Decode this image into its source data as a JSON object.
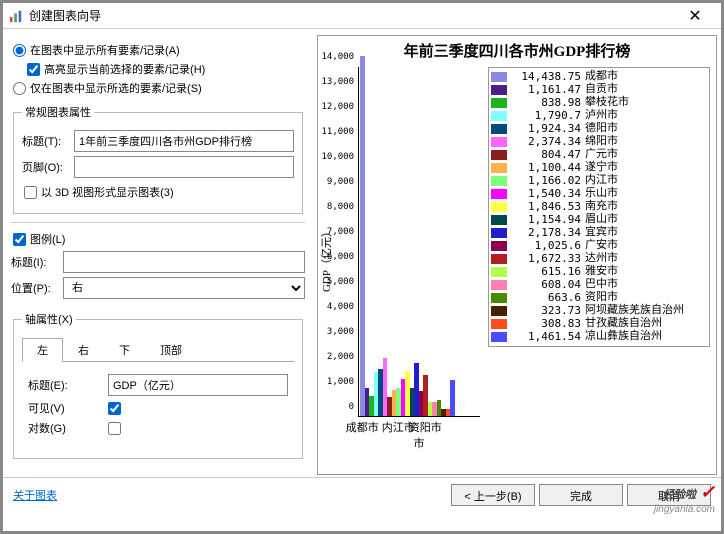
{
  "window": {
    "title": "创建图表向导"
  },
  "options": {
    "show_all": "在图表中显示所有要素/记录(A)",
    "highlight": "高亮显示当前选择的要素/记录(H)",
    "show_selected": "仅在图表中显示所选的要素/记录(S)"
  },
  "general_props": {
    "legend": "常规图表属性",
    "title_label": "标题(T):",
    "title_value": "1年前三季度四川各市州GDP排行榜",
    "footer_label": "页脚(O):",
    "footer_value": "",
    "show_3d": "以 3D 视图形式显示图表(3)"
  },
  "legend_group": {
    "enable": "图例(L)",
    "title_label": "标题(I):",
    "title_value": "",
    "position_label": "位置(P):",
    "position_value": "右"
  },
  "axis_group": {
    "legend": "轴属性(X)",
    "tabs": {
      "left": "左",
      "right": "右",
      "bottom": "下",
      "top": "顶部"
    },
    "title_label": "标题(E):",
    "title_value": "GDP（亿元）",
    "visible_label": "可见(V)",
    "log_label": "对数(G)"
  },
  "footer": {
    "about": "关于图表",
    "back": "< 上一步(B)",
    "finish": "完成",
    "cancel": "取消"
  },
  "watermark": {
    "line1": "经验啦",
    "line2": "jingyanla.com"
  },
  "chart_data": {
    "type": "bar",
    "title": "年前三季度四川各市州GDP排行榜",
    "ylabel": "GDP（亿元）",
    "xlabel": "市",
    "ylim": [
      0,
      14000
    ],
    "yticks": [
      0,
      1000,
      2000,
      3000,
      4000,
      5000,
      6000,
      7000,
      8000,
      9000,
      10000,
      11000,
      12000,
      13000,
      14000
    ],
    "xticks_shown": [
      "成都市",
      "内江市",
      "资阳市"
    ],
    "xtick_positions": [
      0,
      8,
      14
    ],
    "series": [
      {
        "name": "成都市",
        "value": 14438.75,
        "color": "#8a8ae6"
      },
      {
        "name": "自贡市",
        "value": 1161.47,
        "color": "#4a1e8a"
      },
      {
        "name": "攀枝花市",
        "value": 838.98,
        "color": "#1eb41e"
      },
      {
        "name": "泸州市",
        "value": 1790.7,
        "color": "#7fffff"
      },
      {
        "name": "德阳市",
        "value": 1924.34,
        "color": "#004a80"
      },
      {
        "name": "绵阳市",
        "value": 2374.34,
        "color": "#ff66ff"
      },
      {
        "name": "广元市",
        "value": 804.47,
        "color": "#8a1e1e"
      },
      {
        "name": "遂宁市",
        "value": 1100.44,
        "color": "#ffb14a"
      },
      {
        "name": "内江市",
        "value": 1166.02,
        "color": "#7fff7f"
      },
      {
        "name": "乐山市",
        "value": 1540.34,
        "color": "#ff00ff"
      },
      {
        "name": "南充市",
        "value": 1846.53,
        "color": "#ffff4a"
      },
      {
        "name": "眉山市",
        "value": 1154.94,
        "color": "#004a4a"
      },
      {
        "name": "宜宾市",
        "value": 2178.34,
        "color": "#1e1ecc"
      },
      {
        "name": "广安市",
        "value": 1025.6,
        "color": "#8a004a"
      },
      {
        "name": "达州市",
        "value": 1672.33,
        "color": "#b11e1e"
      },
      {
        "name": "雅安市",
        "value": 615.16,
        "color": "#b1ff4a"
      },
      {
        "name": "巴中市",
        "value": 608.04,
        "color": "#ff7fb1"
      },
      {
        "name": "资阳市",
        "value": 663.6,
        "color": "#4a8a00"
      },
      {
        "name": "阿坝藏族羌族自治州",
        "value": 323.73,
        "color": "#4a1e00"
      },
      {
        "name": "甘孜藏族自治州",
        "value": 308.83,
        "color": "#ff4a1e"
      },
      {
        "name": "凉山彝族自治州",
        "value": 1461.54,
        "color": "#4a4aff"
      }
    ]
  }
}
